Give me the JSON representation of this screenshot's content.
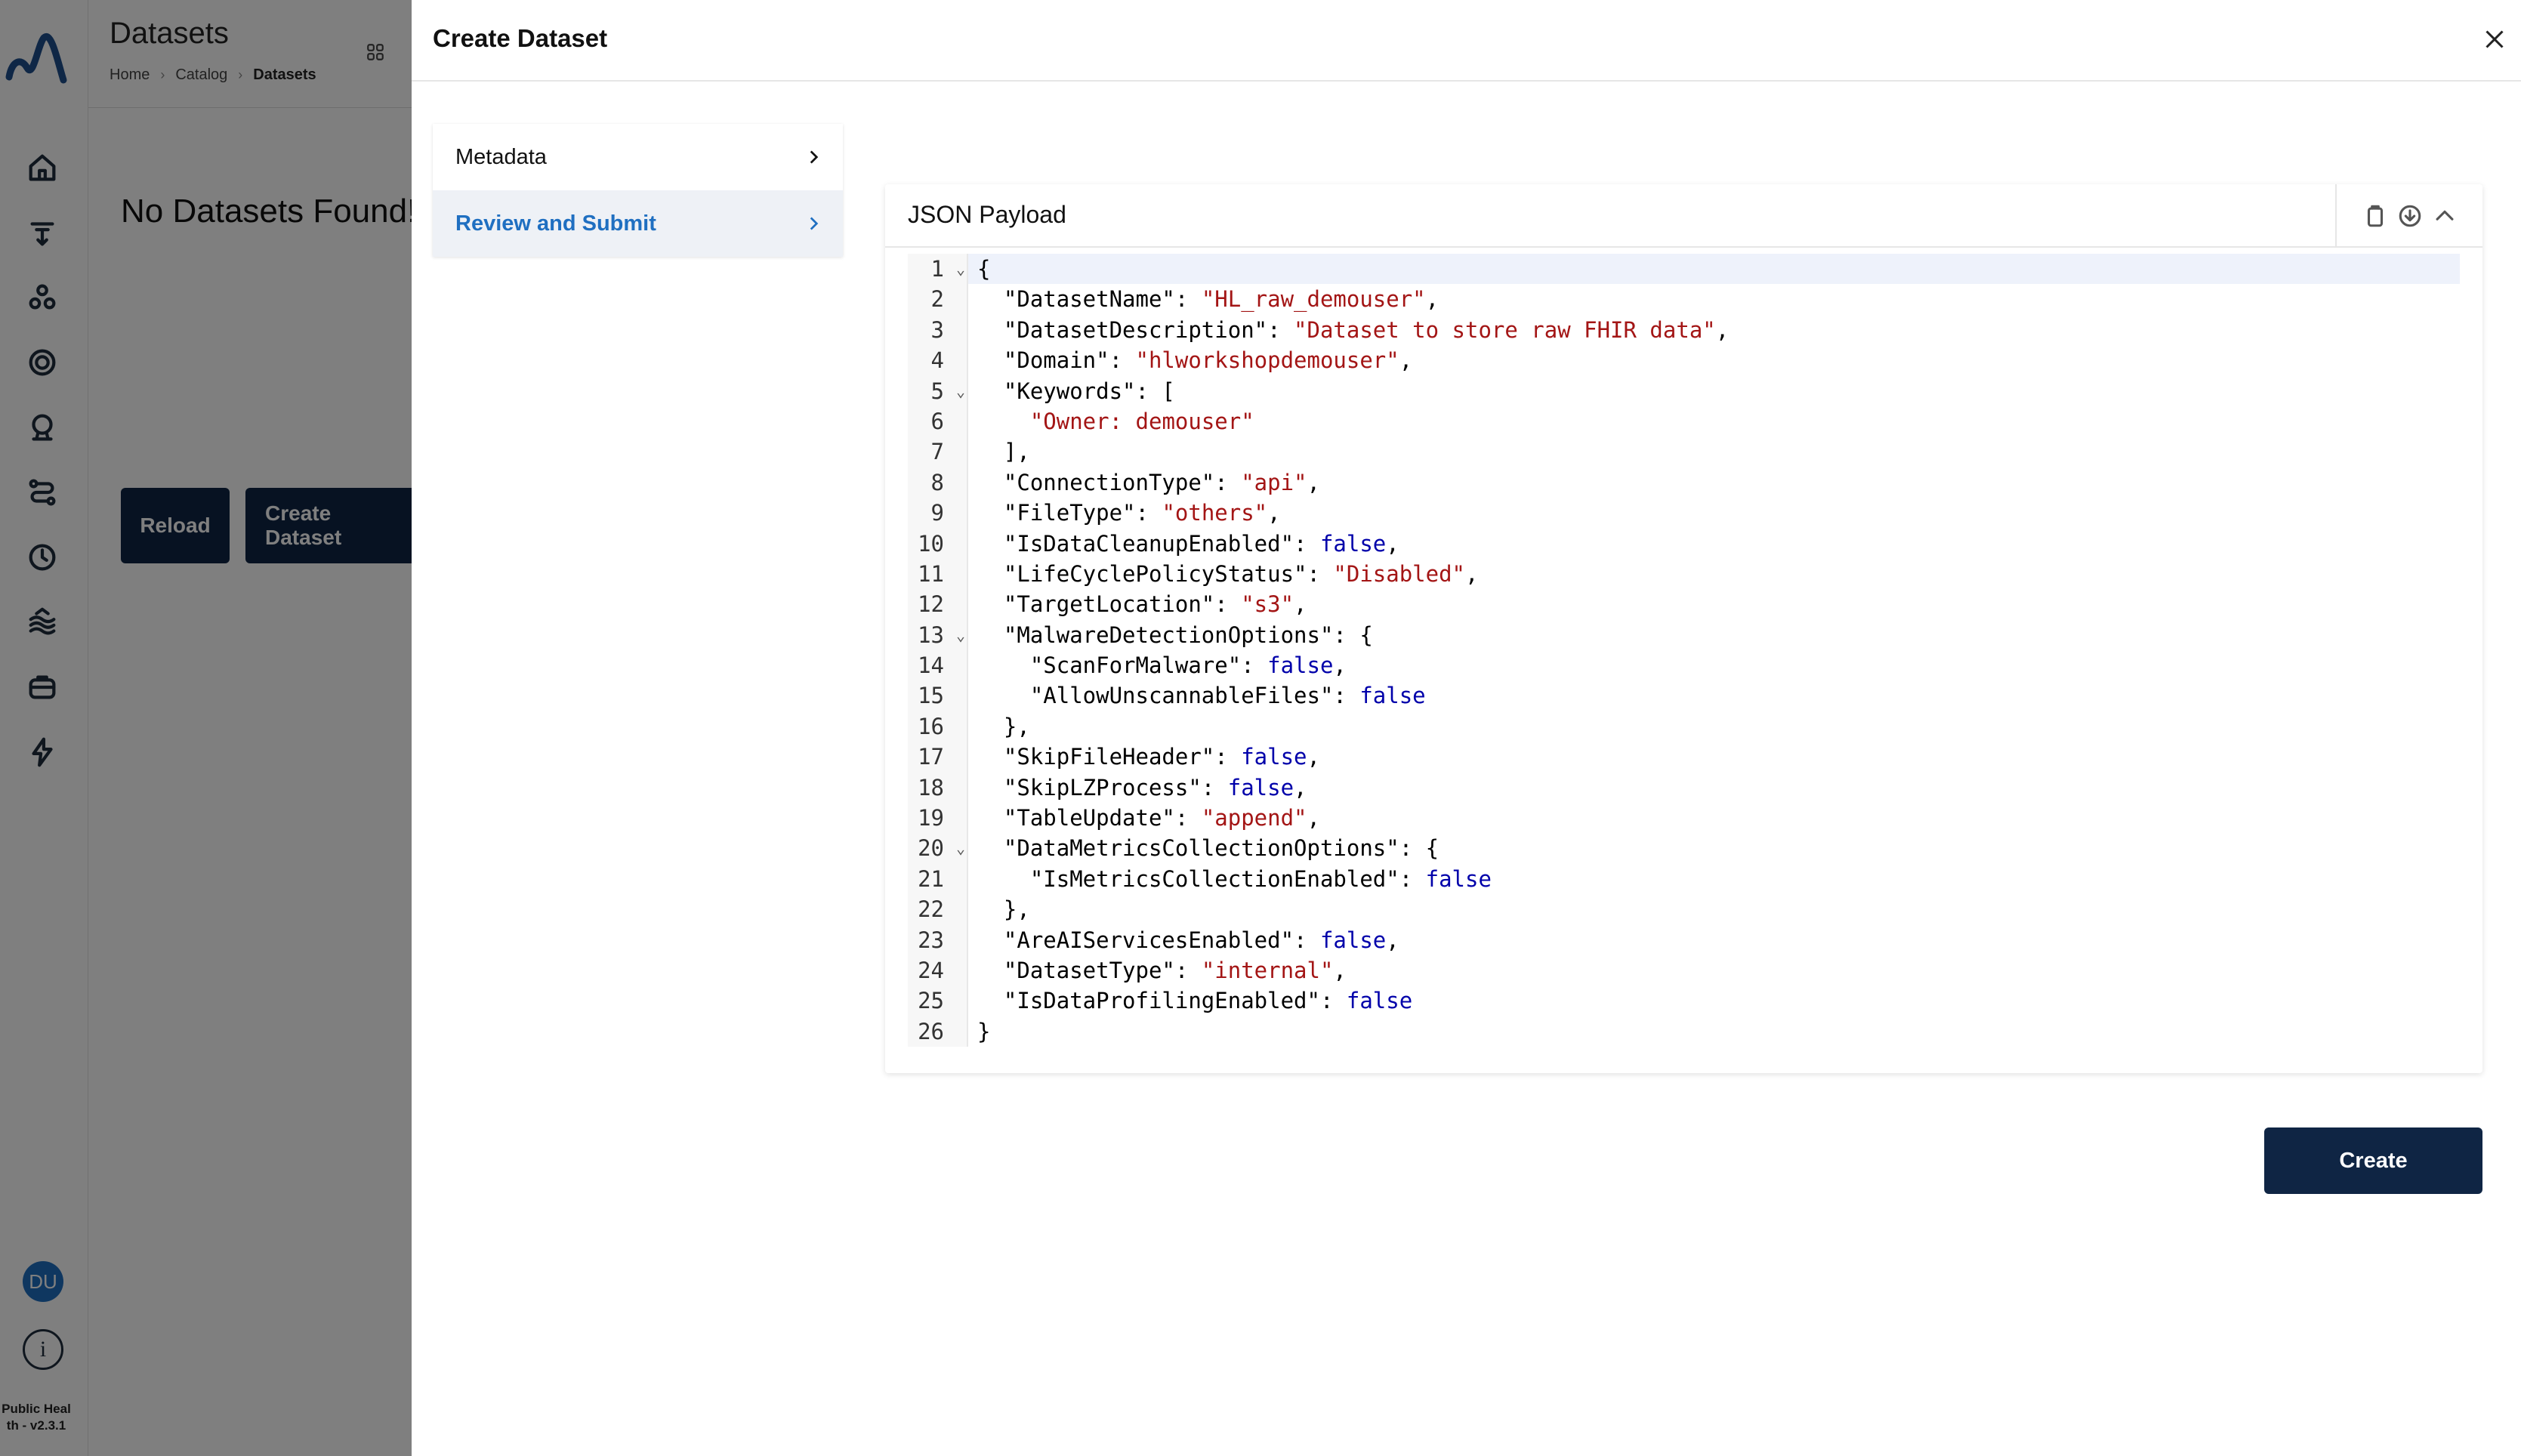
{
  "app": {
    "version_text": "Public Heal th - v2.3.1",
    "user_initials": "DU",
    "colors": {
      "primary_dark": "#0f2544",
      "accent_blue": "#1f6fc1"
    }
  },
  "background": {
    "page_title": "Datasets",
    "breadcrumbs": [
      "Home",
      "Catalog",
      "Datasets"
    ],
    "empty_message": "No Datasets Found!",
    "reload_label": "Reload",
    "create_dataset_label": "Create Dataset"
  },
  "drawer": {
    "title": "Create Dataset",
    "steps": [
      {
        "label": "Metadata",
        "active": false
      },
      {
        "label": "Review and Submit",
        "active": true
      }
    ],
    "payload_title": "JSON Payload",
    "create_label": "Create"
  },
  "code_lines": [
    {
      "n": "1",
      "fold": true,
      "tokens": [
        [
          "k",
          "{"
        ]
      ]
    },
    {
      "n": "2",
      "fold": false,
      "tokens": [
        [
          "k",
          "  \"DatasetName\": "
        ],
        [
          "s",
          "\"HL_raw_demouser\""
        ],
        [
          "k",
          ","
        ]
      ]
    },
    {
      "n": "3",
      "fold": false,
      "tokens": [
        [
          "k",
          "  \"DatasetDescription\": "
        ],
        [
          "s",
          "\"Dataset to store raw FHIR data\""
        ],
        [
          "k",
          ","
        ]
      ]
    },
    {
      "n": "4",
      "fold": false,
      "tokens": [
        [
          "k",
          "  \"Domain\": "
        ],
        [
          "s",
          "\"hlworkshopdemouser\""
        ],
        [
          "k",
          ","
        ]
      ]
    },
    {
      "n": "5",
      "fold": true,
      "tokens": [
        [
          "k",
          "  \"Keywords\": ["
        ]
      ]
    },
    {
      "n": "6",
      "fold": false,
      "tokens": [
        [
          "k",
          "    "
        ],
        [
          "s",
          "\"Owner: demouser\""
        ]
      ]
    },
    {
      "n": "7",
      "fold": false,
      "tokens": [
        [
          "k",
          "  ],"
        ]
      ]
    },
    {
      "n": "8",
      "fold": false,
      "tokens": [
        [
          "k",
          "  \"ConnectionType\": "
        ],
        [
          "s",
          "\"api\""
        ],
        [
          "k",
          ","
        ]
      ]
    },
    {
      "n": "9",
      "fold": false,
      "tokens": [
        [
          "k",
          "  \"FileType\": "
        ],
        [
          "s",
          "\"others\""
        ],
        [
          "k",
          ","
        ]
      ]
    },
    {
      "n": "10",
      "fold": false,
      "tokens": [
        [
          "k",
          "  \"IsDataCleanupEnabled\": "
        ],
        [
          "b",
          "false"
        ],
        [
          "k",
          ","
        ]
      ]
    },
    {
      "n": "11",
      "fold": false,
      "tokens": [
        [
          "k",
          "  \"LifeCyclePolicyStatus\": "
        ],
        [
          "s",
          "\"Disabled\""
        ],
        [
          "k",
          ","
        ]
      ]
    },
    {
      "n": "12",
      "fold": false,
      "tokens": [
        [
          "k",
          "  \"TargetLocation\": "
        ],
        [
          "s",
          "\"s3\""
        ],
        [
          "k",
          ","
        ]
      ]
    },
    {
      "n": "13",
      "fold": true,
      "tokens": [
        [
          "k",
          "  \"MalwareDetectionOptions\": {"
        ]
      ]
    },
    {
      "n": "14",
      "fold": false,
      "tokens": [
        [
          "k",
          "    \"ScanForMalware\": "
        ],
        [
          "b",
          "false"
        ],
        [
          "k",
          ","
        ]
      ]
    },
    {
      "n": "15",
      "fold": false,
      "tokens": [
        [
          "k",
          "    \"AllowUnscannableFiles\": "
        ],
        [
          "b",
          "false"
        ]
      ]
    },
    {
      "n": "16",
      "fold": false,
      "tokens": [
        [
          "k",
          "  },"
        ]
      ]
    },
    {
      "n": "17",
      "fold": false,
      "tokens": [
        [
          "k",
          "  \"SkipFileHeader\": "
        ],
        [
          "b",
          "false"
        ],
        [
          "k",
          ","
        ]
      ]
    },
    {
      "n": "18",
      "fold": false,
      "tokens": [
        [
          "k",
          "  \"SkipLZProcess\": "
        ],
        [
          "b",
          "false"
        ],
        [
          "k",
          ","
        ]
      ]
    },
    {
      "n": "19",
      "fold": false,
      "tokens": [
        [
          "k",
          "  \"TableUpdate\": "
        ],
        [
          "s",
          "\"append\""
        ],
        [
          "k",
          ","
        ]
      ]
    },
    {
      "n": "20",
      "fold": true,
      "tokens": [
        [
          "k",
          "  \"DataMetricsCollectionOptions\": {"
        ]
      ]
    },
    {
      "n": "21",
      "fold": false,
      "tokens": [
        [
          "k",
          "    \"IsMetricsCollectionEnabled\": "
        ],
        [
          "b",
          "false"
        ]
      ]
    },
    {
      "n": "22",
      "fold": false,
      "tokens": [
        [
          "k",
          "  },"
        ]
      ]
    },
    {
      "n": "23",
      "fold": false,
      "tokens": [
        [
          "k",
          "  \"AreAIServicesEnabled\": "
        ],
        [
          "b",
          "false"
        ],
        [
          "k",
          ","
        ]
      ]
    },
    {
      "n": "24",
      "fold": false,
      "tokens": [
        [
          "k",
          "  \"DatasetType\": "
        ],
        [
          "s",
          "\"internal\""
        ],
        [
          "k",
          ","
        ]
      ]
    },
    {
      "n": "25",
      "fold": false,
      "tokens": [
        [
          "k",
          "  \"IsDataProfilingEnabled\": "
        ],
        [
          "b",
          "false"
        ]
      ]
    },
    {
      "n": "26",
      "fold": false,
      "tokens": [
        [
          "k",
          "}"
        ]
      ]
    }
  ]
}
